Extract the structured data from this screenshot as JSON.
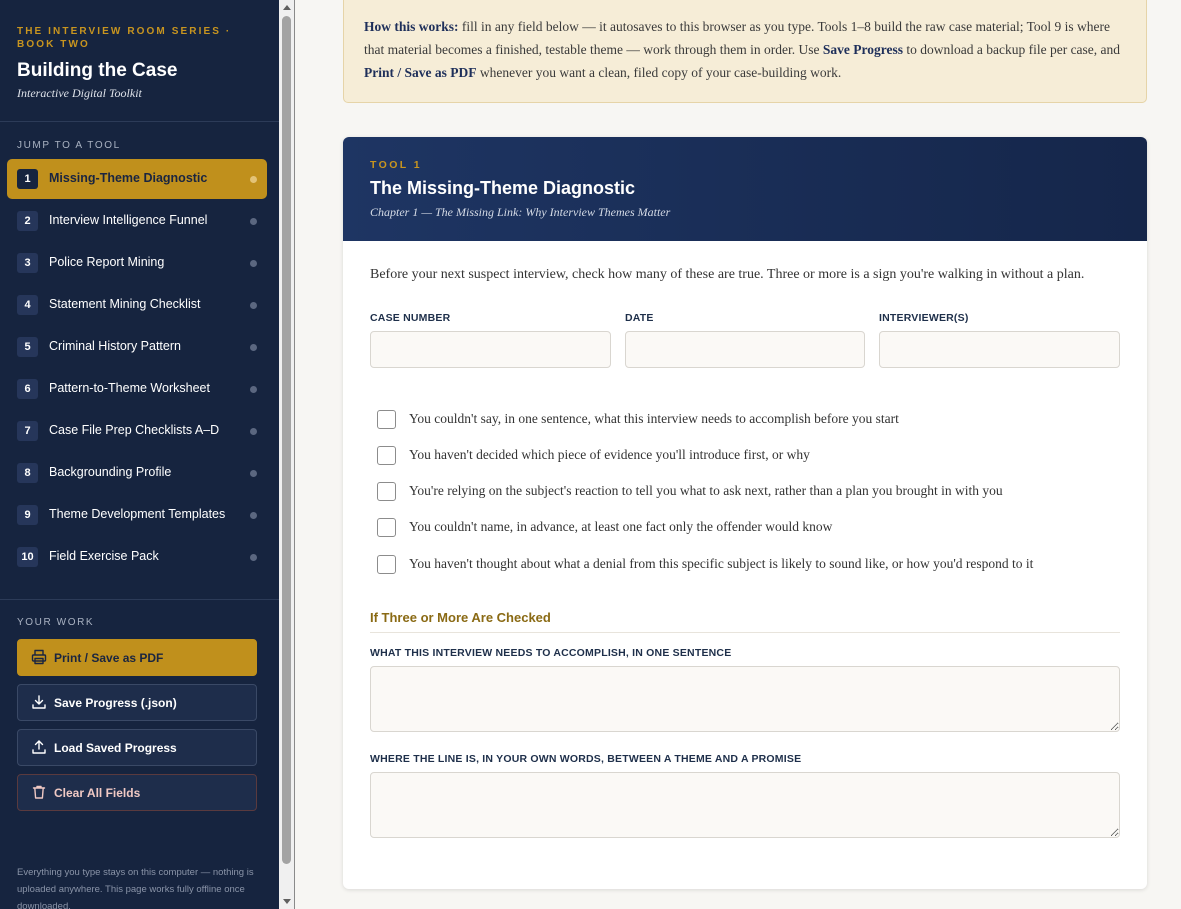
{
  "sidebar": {
    "series": "The Interview Room Series · Book Two",
    "title": "Building the Case",
    "subtitle": "Interactive Digital Toolkit",
    "jump_heading": "Jump to a Tool",
    "tools": [
      {
        "num": "1",
        "label": "Missing-Theme Diagnostic"
      },
      {
        "num": "2",
        "label": "Interview Intelligence Funnel"
      },
      {
        "num": "3",
        "label": "Police Report Mining"
      },
      {
        "num": "4",
        "label": "Statement Mining Checklist"
      },
      {
        "num": "5",
        "label": "Criminal History Pattern"
      },
      {
        "num": "6",
        "label": "Pattern-to-Theme Worksheet"
      },
      {
        "num": "7",
        "label": "Case File Prep Checklists A–D"
      },
      {
        "num": "8",
        "label": "Backgrounding Profile"
      },
      {
        "num": "9",
        "label": "Theme Development Templates"
      },
      {
        "num": "10",
        "label": "Field Exercise Pack"
      }
    ],
    "work_heading": "Your Work",
    "buttons": {
      "print": "Print / Save as PDF",
      "save": "Save Progress (.json)",
      "load": "Load Saved Progress",
      "clear": "Clear All Fields"
    },
    "note": "Everything you type stays on this computer — nothing is uploaded anywhere. This page works fully offline once downloaded."
  },
  "info": {
    "lead": "How this works:",
    "text1": " fill in any field below — it autosaves to this browser as you type. Tools 1–8 build the raw case material; Tool 9 is where that material becomes a finished, testable theme — work through them in order. Use ",
    "save_ref": "Save Progress",
    "text2": " to download a backup file per case, and ",
    "print_ref": "Print / Save as PDF",
    "text3": " whenever you want a clean, filed copy of your case-building work."
  },
  "tool": {
    "kicker": "TOOL 1",
    "title": "The Missing-Theme Diagnostic",
    "chapter": "Chapter 1 — The Missing Link: Why Interview Themes Matter",
    "intro": "Before your next suspect interview, check how many of these are true. Three or more is a sign you're walking in without a plan.",
    "fields": {
      "case_number": {
        "label": "Case Number",
        "value": ""
      },
      "date": {
        "label": "Date",
        "value": ""
      },
      "interviewers": {
        "label": "Interviewer(s)",
        "value": ""
      }
    },
    "checks": [
      "You couldn't say, in one sentence, what this interview needs to accomplish before you start",
      "You haven't decided which piece of evidence you'll introduce first, or why",
      "You're relying on the subject's reaction to tell you what to ask next, rather than a plan you brought in with you",
      "You couldn't name, in advance, at least one fact only the offender would know",
      "You haven't thought about what a denial from this specific subject is likely to sound like, or how you'd respond to it"
    ],
    "followup_heading": "If Three or More Are Checked",
    "textareas": {
      "goal": {
        "label": "What this interview needs to accomplish, in one sentence",
        "value": ""
      },
      "line": {
        "label": "Where the line is, in your own words, between a theme and a promise",
        "value": ""
      }
    }
  }
}
